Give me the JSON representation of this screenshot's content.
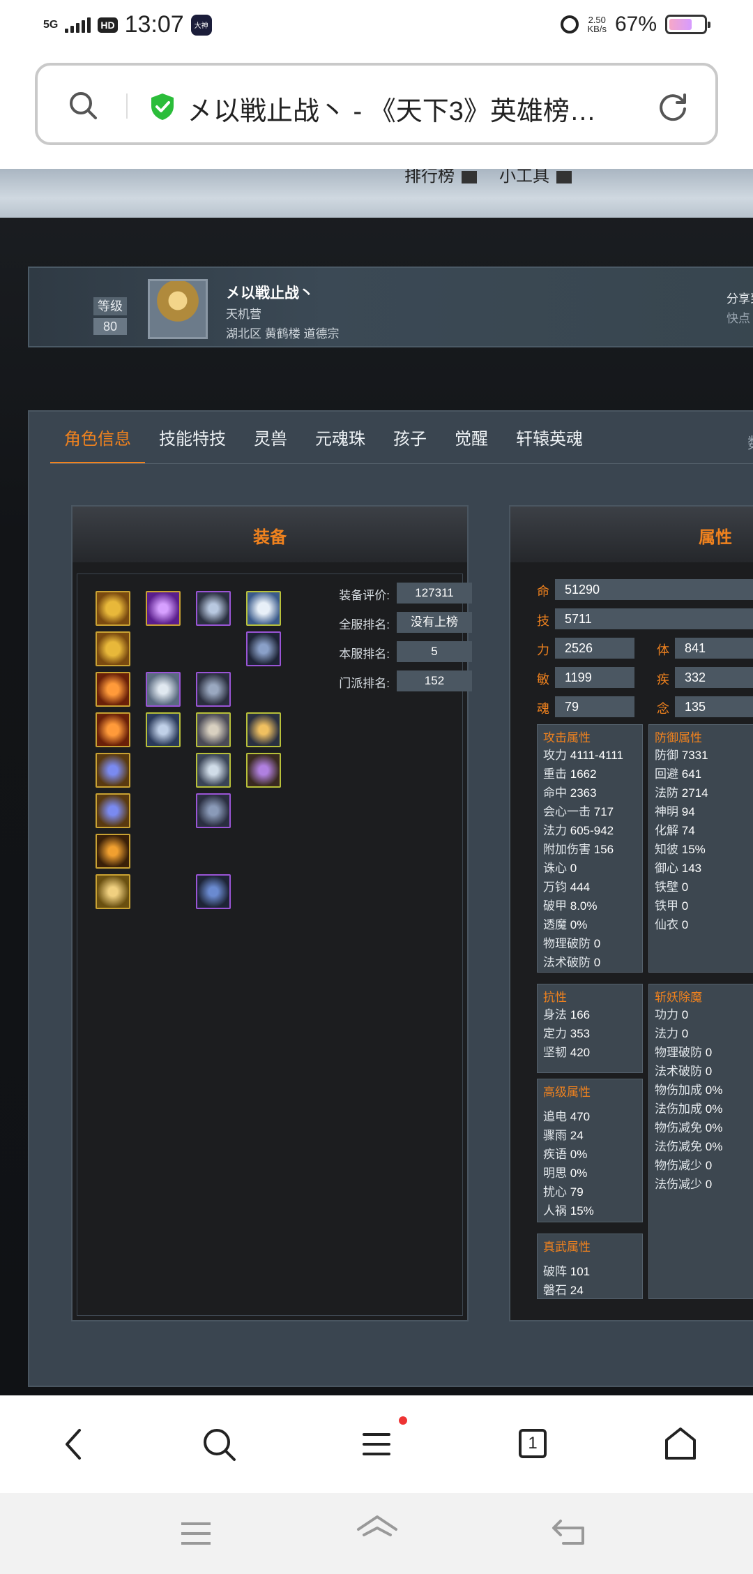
{
  "status_bar": {
    "network": "5G",
    "hd": "HD",
    "time": "13:07",
    "app_badge": "大神",
    "speed_value": "2.50",
    "speed_unit": "KB/s",
    "battery_pct": "67%",
    "battery_level": 0.67
  },
  "url_bar": {
    "title": "㐅以戦止战丶 - 《天下3》英雄榜…"
  },
  "banner": {
    "left_text": "排行榜",
    "right_text": "小工具"
  },
  "profile": {
    "level_label": "等级",
    "level_value": "80",
    "name": "㐅以戦止战丶",
    "class": "天机营",
    "server": "湖北区 黄鹤楼 道德宗",
    "share_label": "分享到",
    "share_sub": "快点"
  },
  "tabs": {
    "items": [
      "角色信息",
      "技能特技",
      "灵兽",
      "元魂珠",
      "孩子",
      "觉醒",
      "轩辕英魂"
    ],
    "active_index": 0,
    "more": "数"
  },
  "equipment": {
    "title": "装备",
    "rows": [
      {
        "label": "装备评价:",
        "value": "127311"
      },
      {
        "label": "全服排名:",
        "value": "没有上榜"
      },
      {
        "label": "本服排名:",
        "value": "5"
      },
      {
        "label": "门派排名:",
        "value": "152"
      }
    ]
  },
  "attributes": {
    "title": "属性",
    "base_full": [
      {
        "label": "命",
        "value": "51290"
      },
      {
        "label": "技",
        "value": "5711"
      }
    ],
    "base_pairs": [
      {
        "l1": "力",
        "v1": "2526",
        "l2": "体",
        "v2": "841"
      },
      {
        "l1": "敏",
        "v1": "1199",
        "l2": "疾",
        "v2": "332"
      },
      {
        "l1": "魂",
        "v1": "79",
        "l2": "念",
        "v2": "135"
      }
    ],
    "attack": {
      "title": "攻击属性",
      "items": [
        {
          "k": "攻力",
          "v": "4111-4111"
        },
        {
          "k": "重击",
          "v": "1662"
        },
        {
          "k": "命中",
          "v": "2363"
        },
        {
          "k": "会心一击",
          "v": "717"
        },
        {
          "k": "法力",
          "v": "605-942"
        },
        {
          "k": "附加伤害",
          "v": "156"
        },
        {
          "k": "诛心",
          "v": "0"
        },
        {
          "k": "万钧",
          "v": "444"
        },
        {
          "k": "破甲",
          "v": "8.0%"
        },
        {
          "k": "透魔",
          "v": "0%"
        },
        {
          "k": "物理破防",
          "v": "0"
        },
        {
          "k": "法术破防",
          "v": "0"
        }
      ]
    },
    "defense": {
      "title": "防御属性",
      "items": [
        {
          "k": "防御",
          "v": "7331"
        },
        {
          "k": "回避",
          "v": "641"
        },
        {
          "k": "法防",
          "v": "2714"
        },
        {
          "k": "神明",
          "v": "94"
        },
        {
          "k": "化解",
          "v": "74"
        },
        {
          "k": "知彼",
          "v": "15%"
        },
        {
          "k": "御心",
          "v": "143"
        },
        {
          "k": "铁壁",
          "v": "0"
        },
        {
          "k": "铁甲",
          "v": "0"
        },
        {
          "k": "仙衣",
          "v": "0"
        }
      ]
    },
    "resist": {
      "title": "抗性",
      "items": [
        {
          "k": "身法",
          "v": "166"
        },
        {
          "k": "定力",
          "v": "353"
        },
        {
          "k": "坚韧",
          "v": "420"
        }
      ]
    },
    "demon": {
      "title": "斩妖除魔",
      "items": [
        {
          "k": "功力",
          "v": "0"
        },
        {
          "k": "法力",
          "v": "0"
        },
        {
          "k": "物理破防",
          "v": "0"
        },
        {
          "k": "法术破防",
          "v": "0"
        },
        {
          "k": "物伤加成",
          "v": "0%"
        },
        {
          "k": "法伤加成",
          "v": "0%"
        },
        {
          "k": "物伤减免",
          "v": "0%"
        },
        {
          "k": "法伤减免",
          "v": "0%"
        },
        {
          "k": "物伤减少",
          "v": "0"
        },
        {
          "k": "法伤减少",
          "v": "0"
        }
      ]
    },
    "advanced": {
      "title": "高级属性",
      "items": [
        {
          "k": "追电",
          "v": "470"
        },
        {
          "k": "骤雨",
          "v": "24"
        },
        {
          "k": "疾语",
          "v": "0%"
        },
        {
          "k": "明思",
          "v": "0%"
        },
        {
          "k": "扰心",
          "v": "79"
        },
        {
          "k": "人祸",
          "v": "15%"
        }
      ]
    },
    "martial": {
      "title": "真武属性",
      "items": [
        {
          "k": "破阵",
          "v": "101"
        },
        {
          "k": "磐石",
          "v": "24"
        }
      ]
    }
  },
  "colors": {
    "accent": "#f0821e",
    "panel": "#3a4550",
    "legendary_border": "#c9a233",
    "epic_border": "#9a55d6",
    "set_border": "#b8c03a"
  },
  "bottom_nav": {
    "tab_count": "1"
  }
}
